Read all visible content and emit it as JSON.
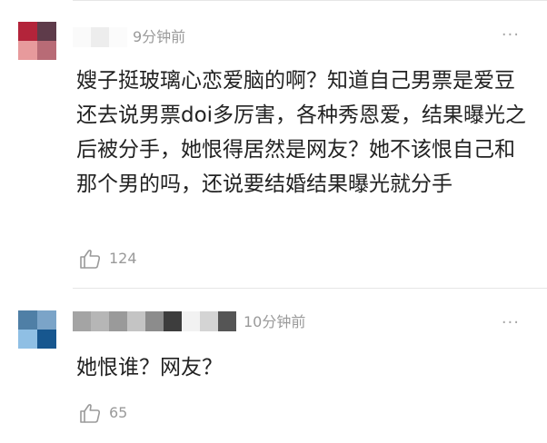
{
  "comments": [
    {
      "time": "9分钟前",
      "more_label": "···",
      "content": "嫂子挺玻璃心恋爱脑的啊？知道自己男票是爱豆还去说男票doi多厉害，各种秀恩爱，结果曝光之后被分手，她恨得居然是网友？她不该恨自己和那个男的吗，还说要结婚结果曝光就分手",
      "likes": "124",
      "avatar_colors": [
        "#b3243a",
        "#5e3b4a",
        "#e79a9c",
        "#b86b76"
      ],
      "name_mosaic_colors": [
        "#fafafa",
        "#ededed",
        "#fbfbfb"
      ],
      "like_icon": "thumbs-up-outline-icon",
      "more_icon": "more-dots-icon"
    },
    {
      "time": "10分钟前",
      "more_label": "···",
      "content": "她恨谁？网友？",
      "likes": "65",
      "avatar_colors": [
        "#4f7fa6",
        "#7ba4c8",
        "#8fbfe4",
        "#17578f"
      ],
      "name_mosaic_colors": [
        "#a4a4a4",
        "#b6b6b6",
        "#9a9a9a",
        "#c4c4c4",
        "#8c8c8c",
        "#3d3d3d",
        "#f2f2f2",
        "#d4d4d4",
        "#555555"
      ],
      "like_icon": "thumbs-up-outline-icon",
      "more_icon": "more-dots-icon"
    }
  ]
}
